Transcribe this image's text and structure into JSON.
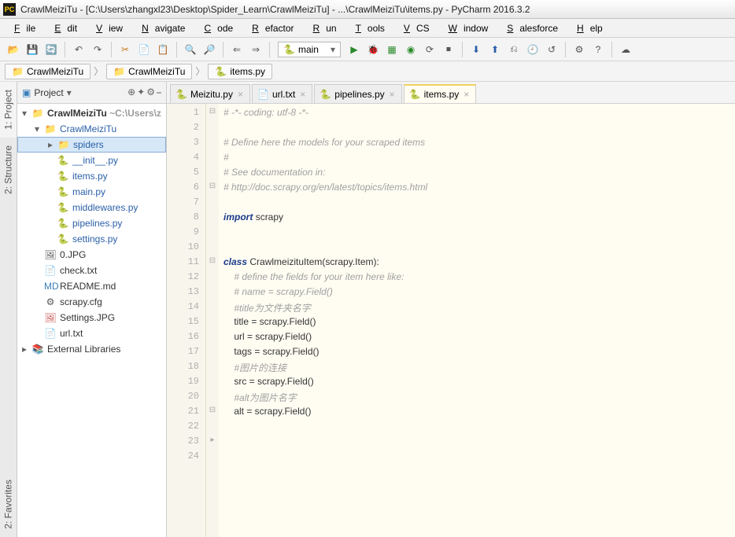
{
  "title": "CrawlMeiziTu - [C:\\Users\\zhangxl23\\Desktop\\Spider_Learn\\CrawlMeiziTu] - ...\\CrawlMeiziTu\\items.py - PyCharm 2016.3.2",
  "menu": [
    "File",
    "Edit",
    "View",
    "Navigate",
    "Code",
    "Refactor",
    "Run",
    "Tools",
    "VCS",
    "Window",
    "Salesforce",
    "Help"
  ],
  "runConfig": "main",
  "breadcrumb": [
    {
      "type": "project",
      "label": "CrawlMeiziTu"
    },
    {
      "type": "project",
      "label": "CrawlMeiziTu"
    },
    {
      "type": "file",
      "label": "items.py"
    }
  ],
  "leftTools": [
    "1: Project",
    "2: Structure",
    "2: Favorites"
  ],
  "projectPanel": {
    "label": "Project",
    "icons": [
      "⊕",
      "✦",
      "⚙",
      "⎯"
    ]
  },
  "tree": [
    {
      "indent": 0,
      "expand": "▾",
      "icon": "folder",
      "label": "CrawlMeiziTu",
      "extra": "~C:\\Users\\z",
      "bold": true
    },
    {
      "indent": 1,
      "expand": "▾",
      "icon": "folder",
      "label": "CrawlMeiziTu",
      "link": true
    },
    {
      "indent": 2,
      "expand": "▸",
      "icon": "folder",
      "label": "spiders",
      "link": true,
      "selected": true
    },
    {
      "indent": 2,
      "expand": " ",
      "icon": "py",
      "label": "__init__.py",
      "link": true
    },
    {
      "indent": 2,
      "expand": " ",
      "icon": "py",
      "label": "items.py",
      "link": true
    },
    {
      "indent": 2,
      "expand": " ",
      "icon": "py",
      "label": "main.py",
      "link": true
    },
    {
      "indent": 2,
      "expand": " ",
      "icon": "py",
      "label": "middlewares.py",
      "link": true
    },
    {
      "indent": 2,
      "expand": " ",
      "icon": "py",
      "label": "pipelines.py",
      "link": true
    },
    {
      "indent": 2,
      "expand": " ",
      "icon": "py",
      "label": "settings.py",
      "link": true
    },
    {
      "indent": 1,
      "expand": " ",
      "icon": "img",
      "label": "0.JPG"
    },
    {
      "indent": 1,
      "expand": " ",
      "icon": "txt",
      "label": "check.txt"
    },
    {
      "indent": 1,
      "expand": " ",
      "icon": "md",
      "label": "README.md"
    },
    {
      "indent": 1,
      "expand": " ",
      "icon": "cfg",
      "label": "scrapy.cfg"
    },
    {
      "indent": 1,
      "expand": " ",
      "icon": "jpg",
      "label": "Settings.JPG"
    },
    {
      "indent": 1,
      "expand": " ",
      "icon": "txt",
      "label": "url.txt"
    },
    {
      "indent": 0,
      "expand": "▸",
      "icon": "lib",
      "label": "External Libraries"
    }
  ],
  "tabs": [
    {
      "icon": "py",
      "label": "Meizitu.py",
      "close": true
    },
    {
      "icon": "txt",
      "label": "url.txt",
      "close": true
    },
    {
      "icon": "py",
      "label": "pipelines.py",
      "close": true
    },
    {
      "icon": "py",
      "label": "items.py",
      "close": true,
      "active": true
    }
  ],
  "code": {
    "lines": [
      {
        "n": 1,
        "html": "<span class='cm'># -*- coding: utf-8 -*-</span>"
      },
      {
        "n": 2,
        "html": ""
      },
      {
        "n": 3,
        "html": "<span class='cm'># Define here the models for your scraped items</span>"
      },
      {
        "n": 4,
        "html": "<span class='cm'>#</span>"
      },
      {
        "n": 5,
        "html": "<span class='cm'># See documentation in:</span>"
      },
      {
        "n": 6,
        "html": "<span class='cm'># http://doc.scrapy.org/en/latest/topics/items.html</span>"
      },
      {
        "n": 7,
        "html": ""
      },
      {
        "n": 8,
        "html": "<span class='kw'>import</span> <span class='nm'>scrapy</span>"
      },
      {
        "n": 9,
        "html": ""
      },
      {
        "n": 10,
        "html": ""
      },
      {
        "n": 11,
        "html": "<span class='kw'>class</span> <span class='nm'>CrawlmeizituItem</span>(scrapy.Item):"
      },
      {
        "n": 12,
        "html": "    <span class='cm'># define the fields for your item here like:</span>"
      },
      {
        "n": 13,
        "html": "    <span class='cm'># name = scrapy.Field()</span>"
      },
      {
        "n": 14,
        "html": "    <span class='cm'>#title为文件夹名字</span>"
      },
      {
        "n": 15,
        "html": "    title = scrapy.Field()"
      },
      {
        "n": 16,
        "html": "    url = scrapy.Field()"
      },
      {
        "n": 17,
        "html": "    tags = scrapy.Field()"
      },
      {
        "n": 18,
        "html": "    <span class='cm'>#图片的连接</span>"
      },
      {
        "n": 19,
        "html": "    src = scrapy.Field()"
      },
      {
        "n": 20,
        "html": "    <span class='cm'>#alt为图片名字</span>"
      },
      {
        "n": 21,
        "html": "    alt = scrapy.Field()"
      },
      {
        "n": 22,
        "html": ""
      },
      {
        "n": 23,
        "html": ""
      },
      {
        "n": 24,
        "html": ""
      }
    ]
  }
}
